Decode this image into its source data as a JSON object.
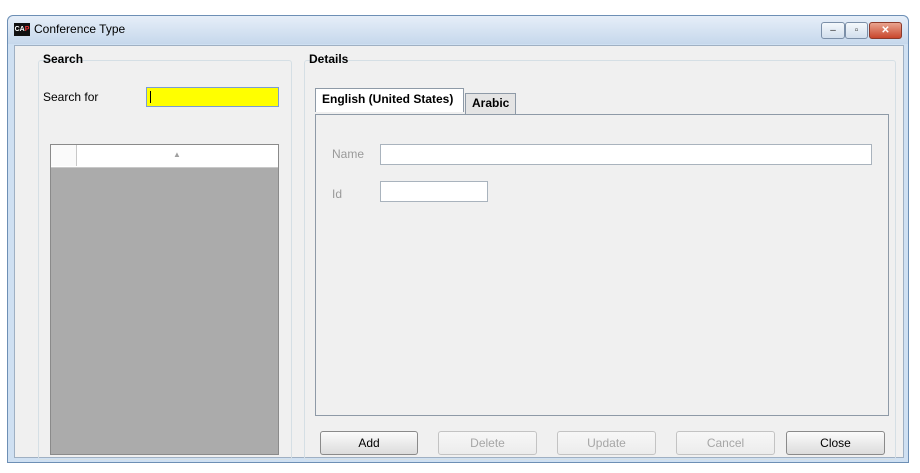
{
  "window": {
    "title": "Conference Type",
    "app_icon_text_a": "CA",
    "app_icon_text_b": "P",
    "controls": [
      "minimize-icon",
      "maximize-icon",
      "close-icon"
    ],
    "minimize_glyph": "–",
    "maximize_glyph": "▫",
    "close_glyph": "✕"
  },
  "search": {
    "section_title": "Search",
    "label": "Search for",
    "value": "",
    "highlight_color": "#ffff00",
    "sort_glyph": "▲"
  },
  "details": {
    "section_title": "Details",
    "tabs": [
      {
        "label": "English (United States)",
        "active": true
      },
      {
        "label": "Arabic",
        "active": false
      }
    ],
    "fields": {
      "name_label": "Name",
      "name_value": "",
      "id_label": "Id",
      "id_value": ""
    }
  },
  "buttons": {
    "add": "Add",
    "delete": "Delete",
    "update": "Update",
    "cancel": "Cancel",
    "close": "Close"
  }
}
